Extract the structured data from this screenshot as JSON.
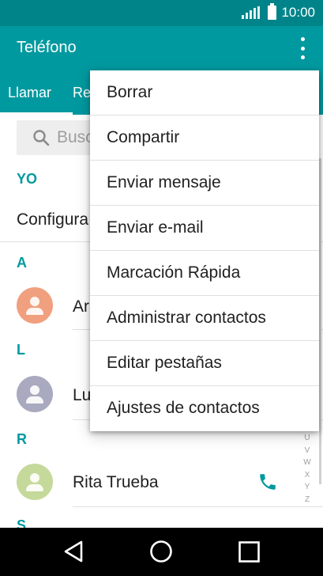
{
  "status": {
    "time": "10:00"
  },
  "app": {
    "title": "Teléfono"
  },
  "tabs": [
    {
      "label": "Llamar"
    },
    {
      "label": "Re"
    }
  ],
  "search": {
    "placeholder": "Busc"
  },
  "sections": {
    "yo": {
      "header": "YO",
      "row": "Configura"
    },
    "a": {
      "header": "A",
      "contact": "Ar"
    },
    "l": {
      "header": "L",
      "contact": "Lu"
    },
    "r": {
      "header": "R",
      "contact": "Rita Trueba"
    },
    "s": {
      "header": "S"
    }
  },
  "alpha_index": [
    "U",
    "V",
    "W",
    "X",
    "Y",
    "Z"
  ],
  "menu": {
    "items": [
      {
        "label": "Borrar"
      },
      {
        "label": "Compartir"
      },
      {
        "label": "Enviar mensaje"
      },
      {
        "label": "Enviar e-mail"
      },
      {
        "label": "Marcación Rápida"
      },
      {
        "label": "Administrar contactos"
      },
      {
        "label": "Editar pestañas"
      },
      {
        "label": "Ajustes de contactos"
      }
    ]
  },
  "colors": {
    "status_bar": "#00848a",
    "app_bar": "#00999f",
    "accent": "#00999f",
    "avatar_a": "#f0a07e",
    "avatar_l": "#a9a9c0",
    "avatar_r": "#c5d99a"
  },
  "icons": {
    "signal": "signal-icon",
    "battery": "battery-icon",
    "overflow": "overflow-menu-icon",
    "search": "search-icon",
    "phone": "phone-icon",
    "back": "back-icon",
    "home": "home-icon",
    "recents": "recents-icon"
  }
}
